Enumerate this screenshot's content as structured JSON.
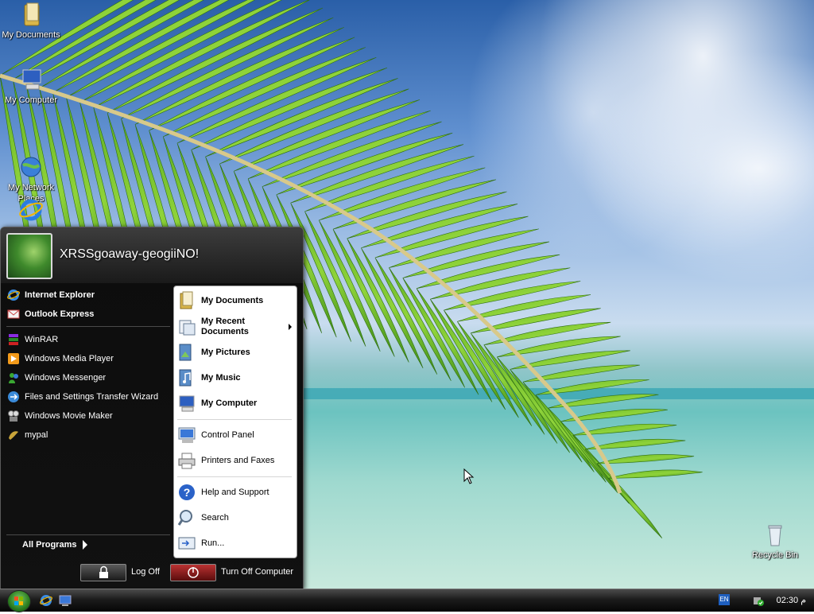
{
  "desktop": {
    "icons": [
      {
        "label": "My Documents",
        "icon": "folder-documents-icon"
      },
      {
        "label": "My Computer",
        "icon": "computer-icon"
      },
      {
        "label": "My Network\nPlaces",
        "icon": "network-globe-icon"
      },
      {
        "label": "",
        "icon": "internet-explorer-icon"
      },
      {
        "label": "Recycle Bin",
        "icon": "recycle-bin-icon"
      }
    ]
  },
  "start_menu": {
    "username": "XRSSgoaway-geogiiNO!",
    "pinned": [
      {
        "label": "Internet Explorer",
        "icon": "internet-explorer-icon"
      },
      {
        "label": "Outlook Express",
        "icon": "outlook-express-icon"
      }
    ],
    "recent": [
      {
        "label": "WinRAR",
        "icon": "winrar-icon"
      },
      {
        "label": "Windows Media Player",
        "icon": "media-player-icon"
      },
      {
        "label": "Windows Messenger",
        "icon": "messenger-icon"
      },
      {
        "label": "Files and Settings Transfer Wizard",
        "icon": "transfer-wizard-icon"
      },
      {
        "label": "Windows Movie Maker",
        "icon": "movie-maker-icon"
      },
      {
        "label": "mypal",
        "icon": "mypal-icon"
      }
    ],
    "all_programs": "All Programs",
    "places": [
      {
        "label": "My Documents",
        "icon": "documents-folder-icon"
      },
      {
        "label": "My Recent Documents",
        "icon": "recent-documents-icon"
      },
      {
        "label": "My Pictures",
        "icon": "pictures-folder-icon"
      },
      {
        "label": "My Music",
        "icon": "music-folder-icon"
      },
      {
        "label": "My Computer",
        "icon": "computer-icon"
      }
    ],
    "settings": [
      {
        "label": "Control Panel",
        "icon": "control-panel-icon"
      },
      {
        "label": "Printers and Faxes",
        "icon": "printer-icon"
      }
    ],
    "tools": [
      {
        "label": "Help and Support",
        "icon": "help-icon"
      },
      {
        "label": "Search",
        "icon": "search-icon"
      },
      {
        "label": "Run...",
        "icon": "run-icon"
      }
    ],
    "log_off": "Log Off",
    "turn_off": "Turn Off Computer"
  },
  "taskbar": {
    "language": "EN",
    "clock": "02:30 م"
  }
}
